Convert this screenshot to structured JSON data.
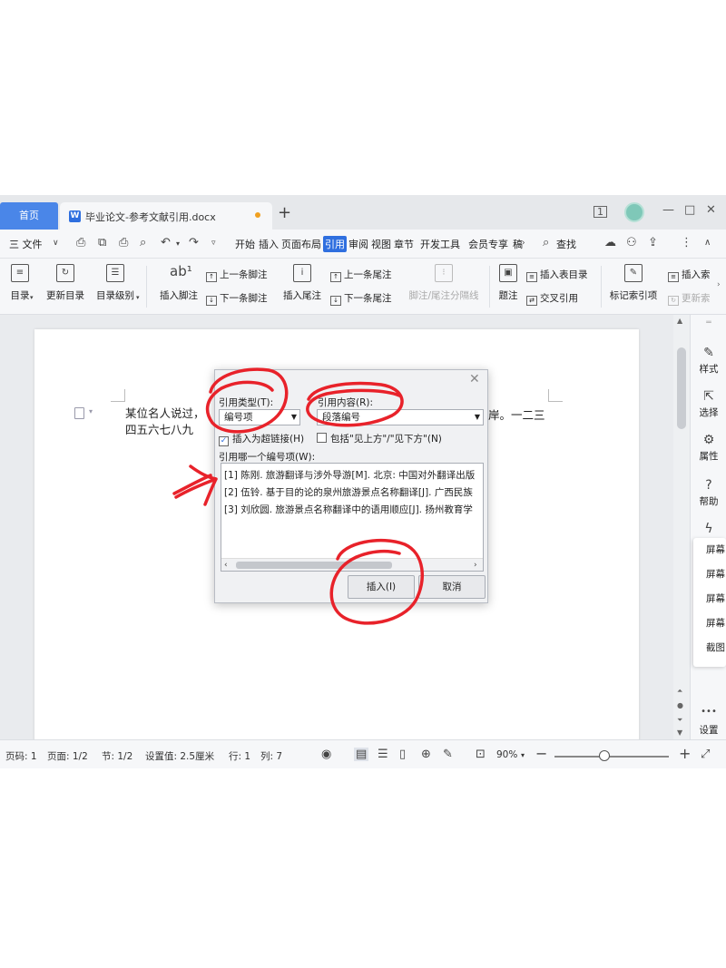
{
  "tabs": {
    "home": "首页",
    "document": "毕业论文-参考文献引用.docx"
  },
  "window": {
    "minimize": "—",
    "maximize": "□",
    "close": "✕"
  },
  "menubar": {
    "file": "三 文件",
    "items": [
      "开始",
      "插入",
      "页面布局",
      "引用",
      "审阅",
      "视图",
      "章节",
      "开发工具",
      "会员专享",
      "稿"
    ],
    "active": "引用",
    "search": "查找"
  },
  "ribbon": {
    "toc": "目录",
    "update_toc": "更新目录",
    "toc_level": "目录级别",
    "insert_footnote": "插入脚注",
    "prev_footnote": "上一条脚注",
    "next_footnote": "下一条脚注",
    "insert_endnote": "插入尾注",
    "prev_endnote": "上一条尾注",
    "next_endnote": "下一条尾注",
    "separator": "脚注/尾注分隔线",
    "caption": "题注",
    "insert_table_toc": "插入表目录",
    "cross_ref": "交叉引用",
    "mark_index": "标记索引项",
    "insert_index": "插入索",
    "update_index": "更新索"
  },
  "document": {
    "line1_left": "某位名人说过，",
    "line1_right": "岸。一二三",
    "line2": "四五六七八九"
  },
  "right_panel": {
    "style": "样式",
    "select": "选择",
    "properties": "属性",
    "help": "帮助",
    "settings": "设置",
    "popout": [
      "屏幕",
      "屏幕",
      "屏幕",
      "屏幕",
      "截图"
    ]
  },
  "statusbar": {
    "page_no": "页码: 1",
    "pages": "页面: 1/2",
    "section": "节: 1/2",
    "setting": "设置值: 2.5厘米",
    "row": "行: 1",
    "col": "列: 7",
    "zoom": "90%"
  },
  "dialog": {
    "ref_type_label": "引用类型(T):",
    "ref_type_value": "编号项",
    "ref_content_label": "引用内容(R):",
    "ref_content_value": "段落编号",
    "hyperlink_label": "插入为超链接(H)",
    "hyperlink_checked": true,
    "above_below_label": "包括\"见上方\"/\"见下方\"(N)",
    "above_below_checked": false,
    "which_item_label": "引用哪一个编号项(W):",
    "items": [
      "[1] 陈刚. 旅游翻译与涉外导游[M]. 北京: 中国对外翻译出版",
      "[2] 伍铃. 基于目的论的泉州旅游景点名称翻译[J]. 广西民族",
      "[3] 刘欣圆. 旅游景点名称翻译中的语用顺应[J]. 扬州教育学"
    ],
    "insert_button": "插入(I)",
    "cancel_button": "取消"
  },
  "colors": {
    "accent": "#2f6fdf",
    "annotation": "#e8222a"
  }
}
